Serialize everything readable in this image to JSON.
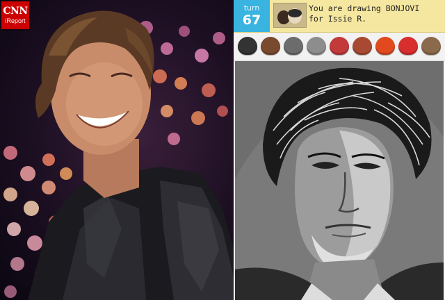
{
  "branding": {
    "logo_text": "CNN",
    "sub_text": "iReport"
  },
  "game": {
    "turn_label": "turn",
    "turn_number": "67",
    "status_line1": "You are drawing BONJOVI",
    "status_line2": "for Issie R."
  },
  "palette": {
    "colors": [
      {
        "name": "black",
        "hex": "#333333"
      },
      {
        "name": "brown",
        "hex": "#7a4a2e"
      },
      {
        "name": "dark-gray",
        "hex": "#6c6c6c"
      },
      {
        "name": "gray",
        "hex": "#8d8d8d"
      },
      {
        "name": "red",
        "hex": "#c23a3a"
      },
      {
        "name": "rust",
        "hex": "#a84a32"
      },
      {
        "name": "orange",
        "hex": "#e04a1e"
      },
      {
        "name": "bright-red",
        "hex": "#d82e2e"
      },
      {
        "name": "tan",
        "hex": "#8a6a4a"
      }
    ]
  },
  "accent_colors": {
    "turn_blue": "#39b3e0",
    "top_bar_yellow": "#f6e7a0"
  }
}
